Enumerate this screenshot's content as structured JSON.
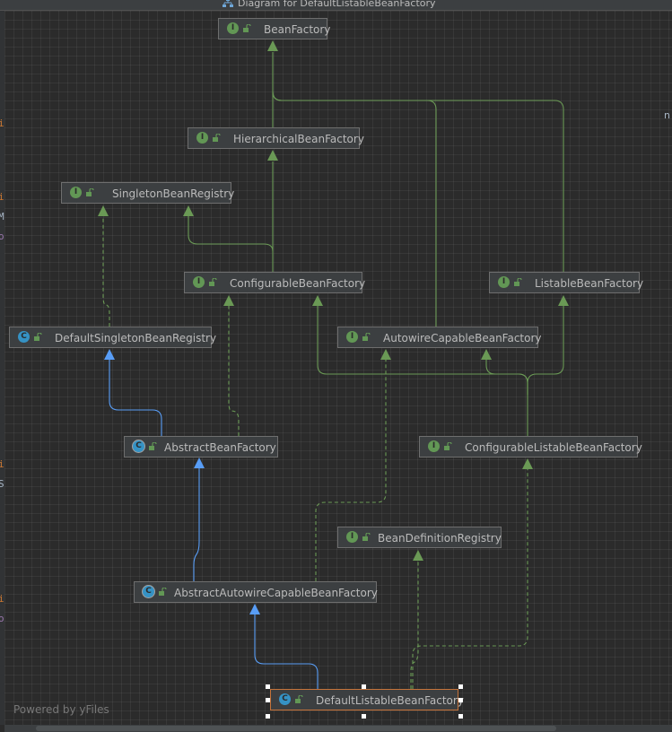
{
  "window": {
    "title": "Diagram for DefaultListableBeanFactory"
  },
  "nodes": [
    {
      "id": "BeanFactory",
      "label": "BeanFactory",
      "kind": "interface",
      "icon_letter": "I"
    },
    {
      "id": "HierarchicalBeanFactory",
      "label": "HierarchicalBeanFactory",
      "kind": "interface",
      "icon_letter": "I"
    },
    {
      "id": "SingletonBeanRegistry",
      "label": "SingletonBeanRegistry",
      "kind": "interface",
      "icon_letter": "I"
    },
    {
      "id": "ConfigurableBeanFactory",
      "label": "ConfigurableBeanFactory",
      "kind": "interface",
      "icon_letter": "I"
    },
    {
      "id": "ListableBeanFactory",
      "label": "ListableBeanFactory",
      "kind": "interface",
      "icon_letter": "I"
    },
    {
      "id": "DefaultSingletonBeanRegistry",
      "label": "DefaultSingletonBeanRegistry",
      "kind": "class",
      "icon_letter": "C"
    },
    {
      "id": "AutowireCapableBeanFactory",
      "label": "AutowireCapableBeanFactory",
      "kind": "interface",
      "icon_letter": "I"
    },
    {
      "id": "AbstractBeanFactory",
      "label": "AbstractBeanFactory",
      "kind": "abstract",
      "icon_letter": "C"
    },
    {
      "id": "ConfigurableListableBeanFactory",
      "label": "ConfigurableListableBeanFactory",
      "kind": "interface",
      "icon_letter": "I"
    },
    {
      "id": "BeanDefinitionRegistry",
      "label": "BeanDefinitionRegistry",
      "kind": "interface",
      "icon_letter": "I"
    },
    {
      "id": "AbstractAutowireCapableBeanFactory",
      "label": "AbstractAutowireCapableBeanFactory",
      "kind": "abstract",
      "icon_letter": "C"
    },
    {
      "id": "DefaultListableBeanFactory",
      "label": "DefaultListableBeanFactory",
      "kind": "class",
      "icon_letter": "C",
      "selected": true
    }
  ],
  "edges": [
    {
      "from": "HierarchicalBeanFactory",
      "to": "BeanFactory",
      "type": "extends"
    },
    {
      "from": "AutowireCapableBeanFactory",
      "to": "BeanFactory",
      "type": "extends"
    },
    {
      "from": "ListableBeanFactory",
      "to": "BeanFactory",
      "type": "extends"
    },
    {
      "from": "ConfigurableBeanFactory",
      "to": "HierarchicalBeanFactory",
      "type": "extends"
    },
    {
      "from": "ConfigurableBeanFactory",
      "to": "SingletonBeanRegistry",
      "type": "extends"
    },
    {
      "from": "DefaultSingletonBeanRegistry",
      "to": "SingletonBeanRegistry",
      "type": "implements"
    },
    {
      "from": "AbstractBeanFactory",
      "to": "DefaultSingletonBeanRegistry",
      "type": "inherits"
    },
    {
      "from": "AbstractBeanFactory",
      "to": "ConfigurableBeanFactory",
      "type": "implements"
    },
    {
      "from": "ConfigurableListableBeanFactory",
      "to": "ConfigurableBeanFactory",
      "type": "extends"
    },
    {
      "from": "ConfigurableListableBeanFactory",
      "to": "AutowireCapableBeanFactory",
      "type": "extends"
    },
    {
      "from": "ConfigurableListableBeanFactory",
      "to": "ListableBeanFactory",
      "type": "extends"
    },
    {
      "from": "AbstractAutowireCapableBeanFactory",
      "to": "AbstractBeanFactory",
      "type": "inherits"
    },
    {
      "from": "AbstractAutowireCapableBeanFactory",
      "to": "AutowireCapableBeanFactory",
      "type": "implements"
    },
    {
      "from": "DefaultListableBeanFactory",
      "to": "AbstractAutowireCapableBeanFactory",
      "type": "inherits"
    },
    {
      "from": "DefaultListableBeanFactory",
      "to": "ConfigurableListableBeanFactory",
      "type": "implements"
    },
    {
      "from": "DefaultListableBeanFactory",
      "to": "BeanDefinitionRegistry",
      "type": "implements"
    }
  ],
  "colors": {
    "interface_edge": "#6a9955",
    "class_edge": "#589df6",
    "interface_icon": "#629755",
    "class_icon": "#3592c4",
    "selection": "#c5733a"
  },
  "footer": {
    "watermark": "Powered by yFiles"
  },
  "left_gutter_glyphs": [
    "i",
    "i",
    "M",
    "o",
    "i",
    "S",
    "i",
    "o"
  ],
  "right_fragment": "n"
}
